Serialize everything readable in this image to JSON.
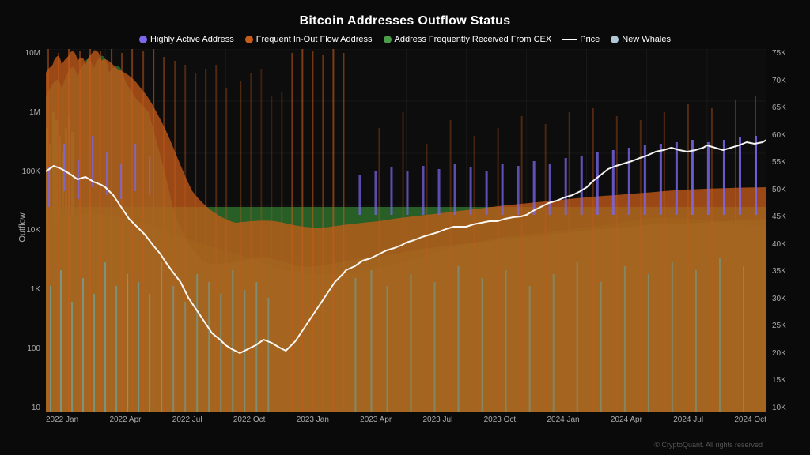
{
  "title": "Bitcoin Addresses Outflow Status",
  "legend": [
    {
      "label": "Highly Active Address",
      "color": "#7b68ee",
      "type": "dot"
    },
    {
      "label": "Frequent In-Out Flow Address",
      "color": "#c85c1a",
      "type": "dot"
    },
    {
      "label": "Address Frequently Received From CEX",
      "color": "#4a9e4a",
      "type": "dot"
    },
    {
      "label": "Price",
      "color": "#ffffff",
      "type": "line"
    },
    {
      "label": "New Whales",
      "color": "#b0c8d8",
      "type": "dot"
    }
  ],
  "yAxisLeft": [
    "10M",
    "1M",
    "100K",
    "10K",
    "1K",
    "100",
    "10"
  ],
  "yAxisRight": [
    "75K",
    "70K",
    "65K",
    "60K",
    "55K",
    "50K",
    "45K",
    "40K",
    "35K",
    "30K",
    "25K",
    "20K",
    "15K",
    "10K"
  ],
  "xAxisLabels": [
    "2022 Jan",
    "2022 Apr",
    "2022 Jul",
    "2022 Oct",
    "2023 Jan",
    "2023 Apr",
    "2023 Jul",
    "2023 Oct",
    "2024 Jan",
    "2024 Apr",
    "2024 Jul",
    "2024 Oct"
  ],
  "yAxisLabel": "Outflow",
  "copyright": "© CryptoQuant. All rights reserved"
}
